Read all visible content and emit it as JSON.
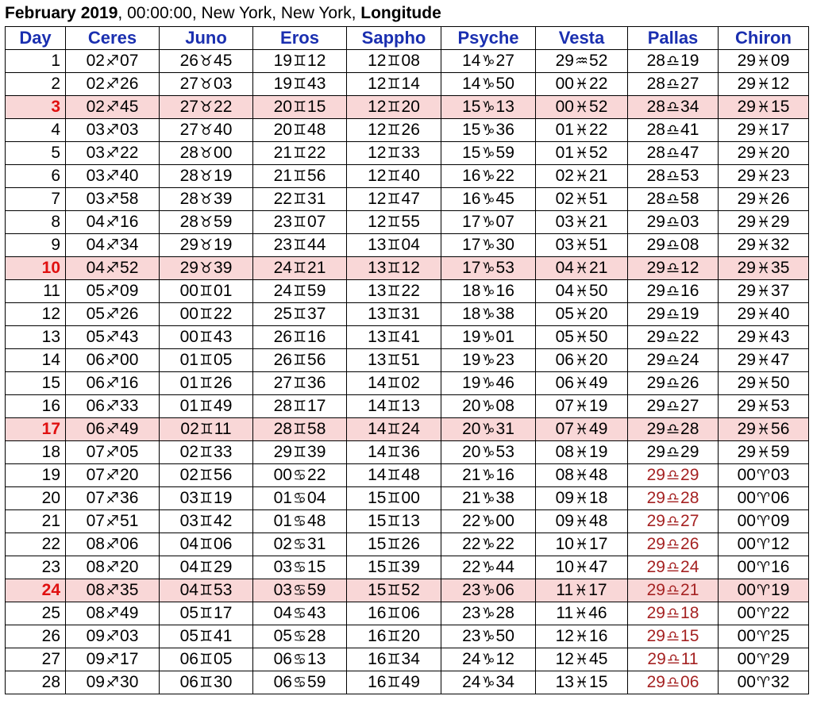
{
  "header": {
    "month_year": "February 2019",
    "rest": ", 00:00:00, New York, New York, ",
    "mode": "Longitude"
  },
  "colors": {
    "header_text": "#1a2fb0",
    "highlight_row": "#f9d7d7",
    "highlight_day": "#e01010",
    "retrograde": "#a52222"
  },
  "columns": [
    "Day",
    "Ceres",
    "Juno",
    "Eros",
    "Sappho",
    "Psyche",
    "Vesta",
    "Pallas",
    "Chiron"
  ],
  "glyphs": {
    "sag": "♐",
    "tau": "♉",
    "gem": "♊",
    "can": "♋",
    "cap": "♑",
    "aqu": "♒",
    "pis": "♓",
    "lib": "♎",
    "ari": "♈"
  },
  "rows": [
    {
      "day": "1",
      "hl": false,
      "ceres": [
        "02",
        "sag",
        "07"
      ],
      "juno": [
        "26",
        "tau",
        "45"
      ],
      "eros": [
        "19",
        "gem",
        "12"
      ],
      "sappho": [
        "12",
        "gem",
        "08"
      ],
      "psyche": [
        "14",
        "cap",
        "27"
      ],
      "vesta": [
        "29",
        "aqu",
        "52"
      ],
      "pallas": [
        "28",
        "lib",
        "19"
      ],
      "chiron": [
        "29",
        "pis",
        "09"
      ],
      "pallas_rx": false
    },
    {
      "day": "2",
      "hl": false,
      "ceres": [
        "02",
        "sag",
        "26"
      ],
      "juno": [
        "27",
        "tau",
        "03"
      ],
      "eros": [
        "19",
        "gem",
        "43"
      ],
      "sappho": [
        "12",
        "gem",
        "14"
      ],
      "psyche": [
        "14",
        "cap",
        "50"
      ],
      "vesta": [
        "00",
        "pis",
        "22"
      ],
      "pallas": [
        "28",
        "lib",
        "27"
      ],
      "chiron": [
        "29",
        "pis",
        "12"
      ],
      "pallas_rx": false
    },
    {
      "day": "3",
      "hl": true,
      "ceres": [
        "02",
        "sag",
        "45"
      ],
      "juno": [
        "27",
        "tau",
        "22"
      ],
      "eros": [
        "20",
        "gem",
        "15"
      ],
      "sappho": [
        "12",
        "gem",
        "20"
      ],
      "psyche": [
        "15",
        "cap",
        "13"
      ],
      "vesta": [
        "00",
        "pis",
        "52"
      ],
      "pallas": [
        "28",
        "lib",
        "34"
      ],
      "chiron": [
        "29",
        "pis",
        "15"
      ],
      "pallas_rx": false
    },
    {
      "day": "4",
      "hl": false,
      "ceres": [
        "03",
        "sag",
        "03"
      ],
      "juno": [
        "27",
        "tau",
        "40"
      ],
      "eros": [
        "20",
        "gem",
        "48"
      ],
      "sappho": [
        "12",
        "gem",
        "26"
      ],
      "psyche": [
        "15",
        "cap",
        "36"
      ],
      "vesta": [
        "01",
        "pis",
        "22"
      ],
      "pallas": [
        "28",
        "lib",
        "41"
      ],
      "chiron": [
        "29",
        "pis",
        "17"
      ],
      "pallas_rx": false
    },
    {
      "day": "5",
      "hl": false,
      "ceres": [
        "03",
        "sag",
        "22"
      ],
      "juno": [
        "28",
        "tau",
        "00"
      ],
      "eros": [
        "21",
        "gem",
        "22"
      ],
      "sappho": [
        "12",
        "gem",
        "33"
      ],
      "psyche": [
        "15",
        "cap",
        "59"
      ],
      "vesta": [
        "01",
        "pis",
        "52"
      ],
      "pallas": [
        "28",
        "lib",
        "47"
      ],
      "chiron": [
        "29",
        "pis",
        "20"
      ],
      "pallas_rx": false
    },
    {
      "day": "6",
      "hl": false,
      "ceres": [
        "03",
        "sag",
        "40"
      ],
      "juno": [
        "28",
        "tau",
        "19"
      ],
      "eros": [
        "21",
        "gem",
        "56"
      ],
      "sappho": [
        "12",
        "gem",
        "40"
      ],
      "psyche": [
        "16",
        "cap",
        "22"
      ],
      "vesta": [
        "02",
        "pis",
        "21"
      ],
      "pallas": [
        "28",
        "lib",
        "53"
      ],
      "chiron": [
        "29",
        "pis",
        "23"
      ],
      "pallas_rx": false
    },
    {
      "day": "7",
      "hl": false,
      "ceres": [
        "03",
        "sag",
        "58"
      ],
      "juno": [
        "28",
        "tau",
        "39"
      ],
      "eros": [
        "22",
        "gem",
        "31"
      ],
      "sappho": [
        "12",
        "gem",
        "47"
      ],
      "psyche": [
        "16",
        "cap",
        "45"
      ],
      "vesta": [
        "02",
        "pis",
        "51"
      ],
      "pallas": [
        "28",
        "lib",
        "58"
      ],
      "chiron": [
        "29",
        "pis",
        "26"
      ],
      "pallas_rx": false
    },
    {
      "day": "8",
      "hl": false,
      "ceres": [
        "04",
        "sag",
        "16"
      ],
      "juno": [
        "28",
        "tau",
        "59"
      ],
      "eros": [
        "23",
        "gem",
        "07"
      ],
      "sappho": [
        "12",
        "gem",
        "55"
      ],
      "psyche": [
        "17",
        "cap",
        "07"
      ],
      "vesta": [
        "03",
        "pis",
        "21"
      ],
      "pallas": [
        "29",
        "lib",
        "03"
      ],
      "chiron": [
        "29",
        "pis",
        "29"
      ],
      "pallas_rx": false
    },
    {
      "day": "9",
      "hl": false,
      "ceres": [
        "04",
        "sag",
        "34"
      ],
      "juno": [
        "29",
        "tau",
        "19"
      ],
      "eros": [
        "23",
        "gem",
        "44"
      ],
      "sappho": [
        "13",
        "gem",
        "04"
      ],
      "psyche": [
        "17",
        "cap",
        "30"
      ],
      "vesta": [
        "03",
        "pis",
        "51"
      ],
      "pallas": [
        "29",
        "lib",
        "08"
      ],
      "chiron": [
        "29",
        "pis",
        "32"
      ],
      "pallas_rx": false
    },
    {
      "day": "10",
      "hl": true,
      "ceres": [
        "04",
        "sag",
        "52"
      ],
      "juno": [
        "29",
        "tau",
        "39"
      ],
      "eros": [
        "24",
        "gem",
        "21"
      ],
      "sappho": [
        "13",
        "gem",
        "12"
      ],
      "psyche": [
        "17",
        "cap",
        "53"
      ],
      "vesta": [
        "04",
        "pis",
        "21"
      ],
      "pallas": [
        "29",
        "lib",
        "12"
      ],
      "chiron": [
        "29",
        "pis",
        "35"
      ],
      "pallas_rx": false
    },
    {
      "day": "11",
      "hl": false,
      "ceres": [
        "05",
        "sag",
        "09"
      ],
      "juno": [
        "00",
        "gem",
        "01"
      ],
      "eros": [
        "24",
        "gem",
        "59"
      ],
      "sappho": [
        "13",
        "gem",
        "22"
      ],
      "psyche": [
        "18",
        "cap",
        "16"
      ],
      "vesta": [
        "04",
        "pis",
        "50"
      ],
      "pallas": [
        "29",
        "lib",
        "16"
      ],
      "chiron": [
        "29",
        "pis",
        "37"
      ],
      "pallas_rx": false
    },
    {
      "day": "12",
      "hl": false,
      "ceres": [
        "05",
        "sag",
        "26"
      ],
      "juno": [
        "00",
        "gem",
        "22"
      ],
      "eros": [
        "25",
        "gem",
        "37"
      ],
      "sappho": [
        "13",
        "gem",
        "31"
      ],
      "psyche": [
        "18",
        "cap",
        "38"
      ],
      "vesta": [
        "05",
        "pis",
        "20"
      ],
      "pallas": [
        "29",
        "lib",
        "19"
      ],
      "chiron": [
        "29",
        "pis",
        "40"
      ],
      "pallas_rx": false
    },
    {
      "day": "13",
      "hl": false,
      "ceres": [
        "05",
        "sag",
        "43"
      ],
      "juno": [
        "00",
        "gem",
        "43"
      ],
      "eros": [
        "26",
        "gem",
        "16"
      ],
      "sappho": [
        "13",
        "gem",
        "41"
      ],
      "psyche": [
        "19",
        "cap",
        "01"
      ],
      "vesta": [
        "05",
        "pis",
        "50"
      ],
      "pallas": [
        "29",
        "lib",
        "22"
      ],
      "chiron": [
        "29",
        "pis",
        "43"
      ],
      "pallas_rx": false
    },
    {
      "day": "14",
      "hl": false,
      "ceres": [
        "06",
        "sag",
        "00"
      ],
      "juno": [
        "01",
        "gem",
        "05"
      ],
      "eros": [
        "26",
        "gem",
        "56"
      ],
      "sappho": [
        "13",
        "gem",
        "51"
      ],
      "psyche": [
        "19",
        "cap",
        "23"
      ],
      "vesta": [
        "06",
        "pis",
        "20"
      ],
      "pallas": [
        "29",
        "lib",
        "24"
      ],
      "chiron": [
        "29",
        "pis",
        "47"
      ],
      "pallas_rx": false
    },
    {
      "day": "15",
      "hl": false,
      "ceres": [
        "06",
        "sag",
        "16"
      ],
      "juno": [
        "01",
        "gem",
        "26"
      ],
      "eros": [
        "27",
        "gem",
        "36"
      ],
      "sappho": [
        "14",
        "gem",
        "02"
      ],
      "psyche": [
        "19",
        "cap",
        "46"
      ],
      "vesta": [
        "06",
        "pis",
        "49"
      ],
      "pallas": [
        "29",
        "lib",
        "26"
      ],
      "chiron": [
        "29",
        "pis",
        "50"
      ],
      "pallas_rx": false
    },
    {
      "day": "16",
      "hl": false,
      "ceres": [
        "06",
        "sag",
        "33"
      ],
      "juno": [
        "01",
        "gem",
        "49"
      ],
      "eros": [
        "28",
        "gem",
        "17"
      ],
      "sappho": [
        "14",
        "gem",
        "13"
      ],
      "psyche": [
        "20",
        "cap",
        "08"
      ],
      "vesta": [
        "07",
        "pis",
        "19"
      ],
      "pallas": [
        "29",
        "lib",
        "27"
      ],
      "chiron": [
        "29",
        "pis",
        "53"
      ],
      "pallas_rx": false
    },
    {
      "day": "17",
      "hl": true,
      "ceres": [
        "06",
        "sag",
        "49"
      ],
      "juno": [
        "02",
        "gem",
        "11"
      ],
      "eros": [
        "28",
        "gem",
        "58"
      ],
      "sappho": [
        "14",
        "gem",
        "24"
      ],
      "psyche": [
        "20",
        "cap",
        "31"
      ],
      "vesta": [
        "07",
        "pis",
        "49"
      ],
      "pallas": [
        "29",
        "lib",
        "28"
      ],
      "chiron": [
        "29",
        "pis",
        "56"
      ],
      "pallas_rx": false
    },
    {
      "day": "18",
      "hl": false,
      "ceres": [
        "07",
        "sag",
        "05"
      ],
      "juno": [
        "02",
        "gem",
        "33"
      ],
      "eros": [
        "29",
        "gem",
        "39"
      ],
      "sappho": [
        "14",
        "gem",
        "36"
      ],
      "psyche": [
        "20",
        "cap",
        "53"
      ],
      "vesta": [
        "08",
        "pis",
        "19"
      ],
      "pallas": [
        "29",
        "lib",
        "29"
      ],
      "chiron": [
        "29",
        "pis",
        "59"
      ],
      "pallas_rx": false
    },
    {
      "day": "19",
      "hl": false,
      "ceres": [
        "07",
        "sag",
        "20"
      ],
      "juno": [
        "02",
        "gem",
        "56"
      ],
      "eros": [
        "00",
        "can",
        "22"
      ],
      "sappho": [
        "14",
        "gem",
        "48"
      ],
      "psyche": [
        "21",
        "cap",
        "16"
      ],
      "vesta": [
        "08",
        "pis",
        "48"
      ],
      "pallas": [
        "29",
        "lib",
        "29"
      ],
      "chiron": [
        "00",
        "ari",
        "03"
      ],
      "pallas_rx": true
    },
    {
      "day": "20",
      "hl": false,
      "ceres": [
        "07",
        "sag",
        "36"
      ],
      "juno": [
        "03",
        "gem",
        "19"
      ],
      "eros": [
        "01",
        "can",
        "04"
      ],
      "sappho": [
        "15",
        "gem",
        "00"
      ],
      "psyche": [
        "21",
        "cap",
        "38"
      ],
      "vesta": [
        "09",
        "pis",
        "18"
      ],
      "pallas": [
        "29",
        "lib",
        "28"
      ],
      "chiron": [
        "00",
        "ari",
        "06"
      ],
      "pallas_rx": true
    },
    {
      "day": "21",
      "hl": false,
      "ceres": [
        "07",
        "sag",
        "51"
      ],
      "juno": [
        "03",
        "gem",
        "42"
      ],
      "eros": [
        "01",
        "can",
        "48"
      ],
      "sappho": [
        "15",
        "gem",
        "13"
      ],
      "psyche": [
        "22",
        "cap",
        "00"
      ],
      "vesta": [
        "09",
        "pis",
        "48"
      ],
      "pallas": [
        "29",
        "lib",
        "27"
      ],
      "chiron": [
        "00",
        "ari",
        "09"
      ],
      "pallas_rx": true
    },
    {
      "day": "22",
      "hl": false,
      "ceres": [
        "08",
        "sag",
        "06"
      ],
      "juno": [
        "04",
        "gem",
        "06"
      ],
      "eros": [
        "02",
        "can",
        "31"
      ],
      "sappho": [
        "15",
        "gem",
        "26"
      ],
      "psyche": [
        "22",
        "cap",
        "22"
      ],
      "vesta": [
        "10",
        "pis",
        "17"
      ],
      "pallas": [
        "29",
        "lib",
        "26"
      ],
      "chiron": [
        "00",
        "ari",
        "12"
      ],
      "pallas_rx": true
    },
    {
      "day": "23",
      "hl": false,
      "ceres": [
        "08",
        "sag",
        "20"
      ],
      "juno": [
        "04",
        "gem",
        "29"
      ],
      "eros": [
        "03",
        "can",
        "15"
      ],
      "sappho": [
        "15",
        "gem",
        "39"
      ],
      "psyche": [
        "22",
        "cap",
        "44"
      ],
      "vesta": [
        "10",
        "pis",
        "47"
      ],
      "pallas": [
        "29",
        "lib",
        "24"
      ],
      "chiron": [
        "00",
        "ari",
        "16"
      ],
      "pallas_rx": true
    },
    {
      "day": "24",
      "hl": true,
      "ceres": [
        "08",
        "sag",
        "35"
      ],
      "juno": [
        "04",
        "gem",
        "53"
      ],
      "eros": [
        "03",
        "can",
        "59"
      ],
      "sappho": [
        "15",
        "gem",
        "52"
      ],
      "psyche": [
        "23",
        "cap",
        "06"
      ],
      "vesta": [
        "11",
        "pis",
        "17"
      ],
      "pallas": [
        "29",
        "lib",
        "21"
      ],
      "chiron": [
        "00",
        "ari",
        "19"
      ],
      "pallas_rx": true
    },
    {
      "day": "25",
      "hl": false,
      "ceres": [
        "08",
        "sag",
        "49"
      ],
      "juno": [
        "05",
        "gem",
        "17"
      ],
      "eros": [
        "04",
        "can",
        "43"
      ],
      "sappho": [
        "16",
        "gem",
        "06"
      ],
      "psyche": [
        "23",
        "cap",
        "28"
      ],
      "vesta": [
        "11",
        "pis",
        "46"
      ],
      "pallas": [
        "29",
        "lib",
        "18"
      ],
      "chiron": [
        "00",
        "ari",
        "22"
      ],
      "pallas_rx": true
    },
    {
      "day": "26",
      "hl": false,
      "ceres": [
        "09",
        "sag",
        "03"
      ],
      "juno": [
        "05",
        "gem",
        "41"
      ],
      "eros": [
        "05",
        "can",
        "28"
      ],
      "sappho": [
        "16",
        "gem",
        "20"
      ],
      "psyche": [
        "23",
        "cap",
        "50"
      ],
      "vesta": [
        "12",
        "pis",
        "16"
      ],
      "pallas": [
        "29",
        "lib",
        "15"
      ],
      "chiron": [
        "00",
        "ari",
        "25"
      ],
      "pallas_rx": true
    },
    {
      "day": "27",
      "hl": false,
      "ceres": [
        "09",
        "sag",
        "17"
      ],
      "juno": [
        "06",
        "gem",
        "05"
      ],
      "eros": [
        "06",
        "can",
        "13"
      ],
      "sappho": [
        "16",
        "gem",
        "34"
      ],
      "psyche": [
        "24",
        "cap",
        "12"
      ],
      "vesta": [
        "12",
        "pis",
        "45"
      ],
      "pallas": [
        "29",
        "lib",
        "11"
      ],
      "chiron": [
        "00",
        "ari",
        "29"
      ],
      "pallas_rx": true
    },
    {
      "day": "28",
      "hl": false,
      "ceres": [
        "09",
        "sag",
        "30"
      ],
      "juno": [
        "06",
        "gem",
        "30"
      ],
      "eros": [
        "06",
        "can",
        "59"
      ],
      "sappho": [
        "16",
        "gem",
        "49"
      ],
      "psyche": [
        "24",
        "cap",
        "34"
      ],
      "vesta": [
        "13",
        "pis",
        "15"
      ],
      "pallas": [
        "29",
        "lib",
        "06"
      ],
      "chiron": [
        "00",
        "ari",
        "32"
      ],
      "pallas_rx": true
    }
  ]
}
